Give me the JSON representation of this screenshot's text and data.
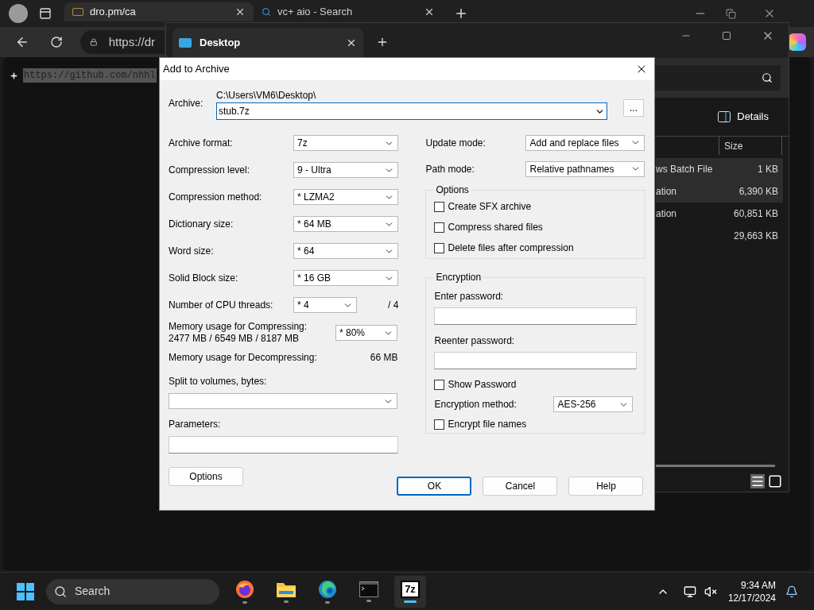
{
  "browser": {
    "tabs": [
      {
        "title": "dro.pm/ca",
        "selected": true,
        "kind": "page"
      },
      {
        "title": "vc+ aio - Search",
        "selected": false,
        "kind": "search"
      }
    ],
    "address": "https://dr",
    "page_text": "https://github.com/nhhl"
  },
  "explorer": {
    "tab_title": "Desktop",
    "details_label": "Details",
    "size_column": "Size",
    "rows": [
      {
        "type": "ws Batch File",
        "size": "1 KB",
        "selected": true
      },
      {
        "type": "ation",
        "size": "6,390 KB",
        "selected": true
      },
      {
        "type": "ation",
        "size": "60,851 KB",
        "selected": false
      },
      {
        "type": "",
        "size": "29,663 KB",
        "selected": false
      }
    ]
  },
  "dialog": {
    "title": "Add to Archive",
    "archive_label": "Archive:",
    "archive_path": "C:\\Users\\VM6\\Desktop\\",
    "archive_value": "stub.7z",
    "browse_label": "...",
    "left_fields": [
      {
        "label": "Archive format:",
        "value": "7z"
      },
      {
        "label": "Compression level:",
        "value": "9 - Ultra"
      },
      {
        "label": "Compression method:",
        "value": "* LZMA2"
      },
      {
        "label": "Dictionary size:",
        "value": "* 64 MB"
      },
      {
        "label": "Word size:",
        "value": "* 64"
      },
      {
        "label": "Solid Block size:",
        "value": "* 16 GB"
      }
    ],
    "threads": {
      "label": "Number of CPU threads:",
      "value": "* 4",
      "max": "/ 4"
    },
    "memory_compress": {
      "label": "Memory usage for Compressing:",
      "detail": "2477 MB / 6549 MB / 8187 MB",
      "value": "* 80%"
    },
    "memory_decompress": {
      "label": "Memory usage for Decompressing:",
      "value": "66 MB"
    },
    "split_label": "Split to volumes, bytes:",
    "parameters_label": "Parameters:",
    "options_button": "Options",
    "right_fields": [
      {
        "label": "Update mode:",
        "value": "Add and replace files"
      },
      {
        "label": "Path mode:",
        "value": "Relative pathnames"
      }
    ],
    "options_group": {
      "title": "Options",
      "checkboxes": [
        {
          "label": "Create SFX archive",
          "checked": false
        },
        {
          "label": "Compress shared files",
          "checked": false
        },
        {
          "label": "Delete files after compression",
          "checked": false
        }
      ]
    },
    "encryption": {
      "title": "Encryption",
      "enter_label": "Enter password:",
      "reenter_label": "Reenter password:",
      "show_password": {
        "label": "Show Password",
        "checked": false
      },
      "method_label": "Encryption method:",
      "method_value": "AES-256",
      "encrypt_names": {
        "label": "Encrypt file names",
        "checked": false
      }
    },
    "buttons": [
      {
        "label": "OK",
        "selected": true
      },
      {
        "label": "Cancel",
        "selected": false
      },
      {
        "label": "Help",
        "selected": false
      }
    ]
  },
  "taskbar": {
    "search_placeholder": "Search",
    "apps": [
      {
        "kind": "firefox",
        "active": false
      },
      {
        "kind": "folder",
        "active": false
      },
      {
        "kind": "edge",
        "active": false
      },
      {
        "kind": "terminal",
        "active": false
      },
      {
        "kind": "sevenzip",
        "label": "7z",
        "active": true
      }
    ],
    "time": "9:34 AM",
    "date": "12/17/2024"
  }
}
